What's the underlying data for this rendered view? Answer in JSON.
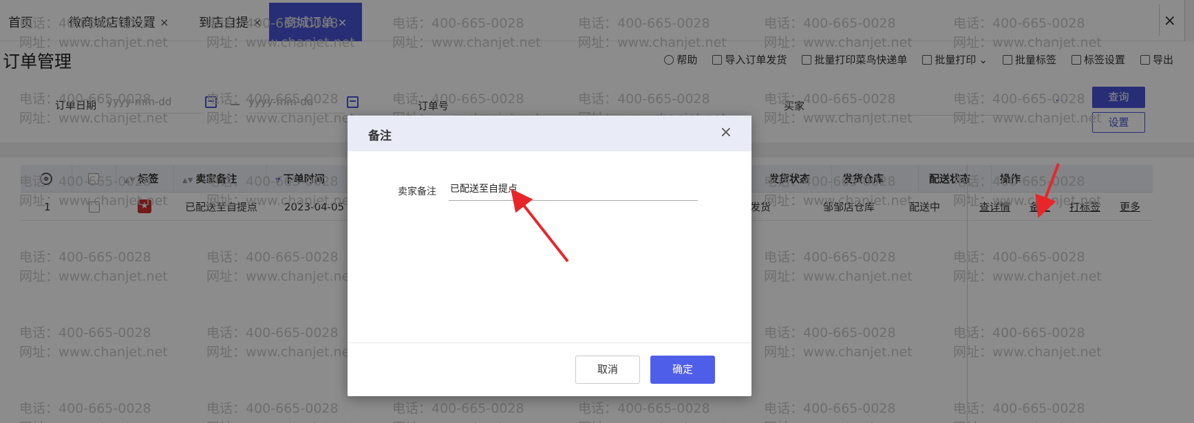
{
  "tabs": [
    {
      "label": "首页",
      "closable": false
    },
    {
      "label": "微商城店铺设置",
      "closable": true
    },
    {
      "label": "到店自提",
      "closable": true
    },
    {
      "label": "商城订单",
      "closable": true,
      "active": true
    }
  ],
  "window": {
    "close_glyph": "×"
  },
  "page": {
    "title": "订单管理"
  },
  "toolbar": {
    "help": "帮助",
    "import": "导入订单发货",
    "batch_print_cainiao": "批量打印菜鸟快递单",
    "batch_print": "批量打印",
    "batch_tag": "批量标签",
    "tag_settings": "标签设置",
    "export": "导出"
  },
  "filters": {
    "order_date_label": "订单日期",
    "date_start_placeholder": "yyyy-mm-dd",
    "date_sep": "—",
    "date_end_placeholder": "yyyy-mm-dd",
    "order_no_label": "订单号",
    "buyer_label": "买家",
    "more": "···",
    "query": "查询",
    "settings": "设置"
  },
  "table": {
    "headers": {
      "tag": "标签",
      "seller_note": "卖家备注",
      "order_time": "下单时间",
      "ship_status": "发货状态",
      "warehouse": "发货仓库",
      "delivery_status": "配送状态",
      "actions": "操作"
    },
    "rows": [
      {
        "index": "1",
        "seller_note": "已配送至自提点",
        "order_time": "2023-04-05 ...",
        "ship_status": "发货",
        "warehouse": "邹邹店仓库",
        "delivery_status": "配送中",
        "actions": [
          "查详情",
          "备注",
          "打标签",
          "更多"
        ]
      }
    ]
  },
  "watermark": {
    "phone": "电话：400-665-0028",
    "site": "网址：www.chanjet.net"
  },
  "modal": {
    "title": "备注",
    "field_label": "卖家备注",
    "field_value": "已配送至自提点",
    "cancel": "取消",
    "confirm": "确定"
  },
  "colors": {
    "accent": "#4a54d6",
    "tag_red": "#d03030",
    "arrow_red": "#e8262a"
  }
}
